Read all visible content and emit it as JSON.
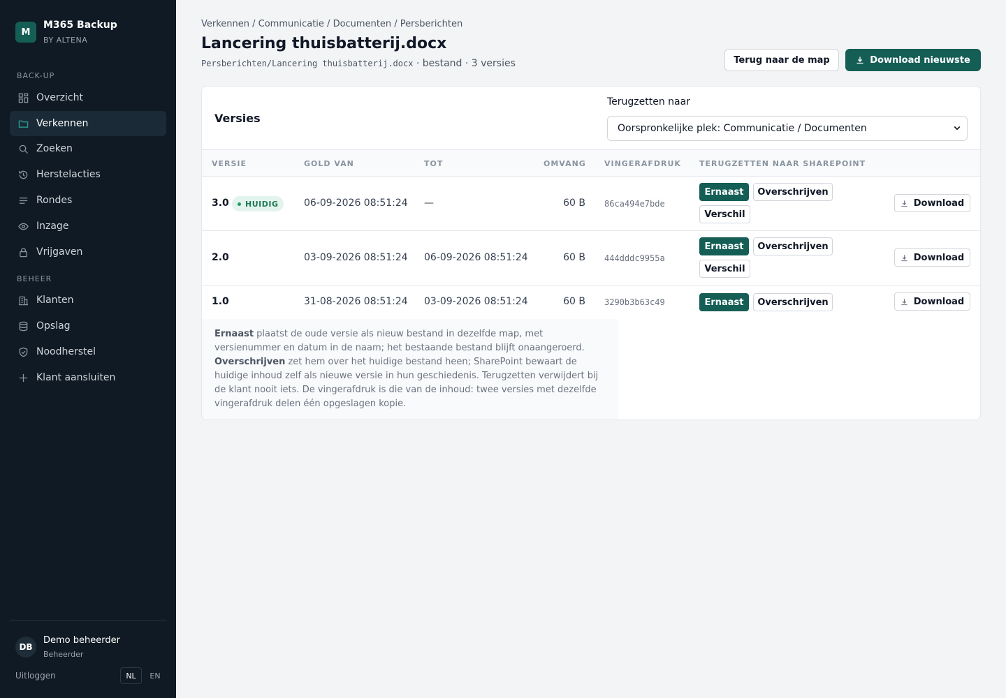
{
  "brand": {
    "logo_letter": "M",
    "title": "M365 Backup",
    "subtitle": "BY ALTENA"
  },
  "nav": {
    "section_backup": "BACK-UP",
    "section_beheer": "BEHEER",
    "items": [
      {
        "label": "Overzicht",
        "icon": "grid-icon"
      },
      {
        "label": "Verkennen",
        "icon": "folder-icon"
      },
      {
        "label": "Zoeken",
        "icon": "search-icon"
      },
      {
        "label": "Herstelacties",
        "icon": "history-icon"
      },
      {
        "label": "Rondes",
        "icon": "list-icon"
      },
      {
        "label": "Inzage",
        "icon": "eye-icon"
      },
      {
        "label": "Vrijgaven",
        "icon": "lock-icon"
      },
      {
        "label": "Klanten",
        "icon": "building-icon"
      },
      {
        "label": "Opslag",
        "icon": "database-icon"
      },
      {
        "label": "Noodherstel",
        "icon": "shield-icon"
      },
      {
        "label": "Klant aansluiten",
        "icon": "plus-icon"
      }
    ]
  },
  "user": {
    "initials": "DB",
    "name": "Demo beheerder",
    "role": "Beheerder",
    "logout": "Uitloggen",
    "lang_nl": "NL",
    "lang_en": "EN"
  },
  "page": {
    "breadcrumb": "Verkennen / Communicatie / Documenten / Persberichten",
    "title": "Lancering thuisbatterij.docx",
    "path": "Persberichten/Lancering thuisbatterij.docx",
    "meta": " · bestand · 3 versies",
    "back_button": "Terug naar de map",
    "download_latest": "Download nieuwste"
  },
  "versions": {
    "title": "Versies",
    "restore_label": "Terugzetten naar",
    "restore_value": "Oorspronkelijke plek: Communicatie / Documenten",
    "headers": {
      "version": "VERSIE",
      "valid_from": "GOLD VAN",
      "until": "TOT",
      "size": "OMVANG",
      "fingerprint": "VINGERAFDRUK",
      "restore": "TERUGZETTEN NAAR SHAREPOINT"
    },
    "current_badge": "HUIDIG",
    "btn_alongside": "Ernaast",
    "btn_overwrite": "Overschrijven",
    "btn_diff": "Verschil",
    "btn_download": "Download",
    "rows": [
      {
        "version": "3.0",
        "from": "06-09-2026 08:51:24",
        "until": "—",
        "size": "60 B",
        "hash": "86ca494e7bde"
      },
      {
        "version": "2.0",
        "from": "03-09-2026 08:51:24",
        "until": "06-09-2026 08:51:24",
        "size": "60 B",
        "hash": "444dddc9955a"
      },
      {
        "version": "1.0",
        "from": "31-08-2026 08:51:24",
        "until": "03-09-2026 08:51:24",
        "size": "60 B",
        "hash": "3290b3b63c49"
      }
    ],
    "note": {
      "alongside_term": "Ernaast",
      "alongside_text": " plaatst de oude versie als nieuw bestand in dezelfde map, met versienummer en datum in de naam; het bestaande bestand blijft onaangeroerd. ",
      "overwrite_term": "Overschrijven",
      "overwrite_text": " zet hem over het huidige bestand heen; SharePoint bewaart de huidige inhoud zelf als nieuwe versie in hun geschiedenis. Terugzetten verwijdert bij de klant nooit iets. De vingerafdruk is die van de inhoud: twee versies met dezelfde vingerafdruk delen één opgeslagen kopie."
    }
  },
  "colors": {
    "sidebar": "#0f1a24",
    "accent": "#155e56",
    "badge_bg": "#e3f4ee",
    "badge_text": "#1f7a55"
  }
}
